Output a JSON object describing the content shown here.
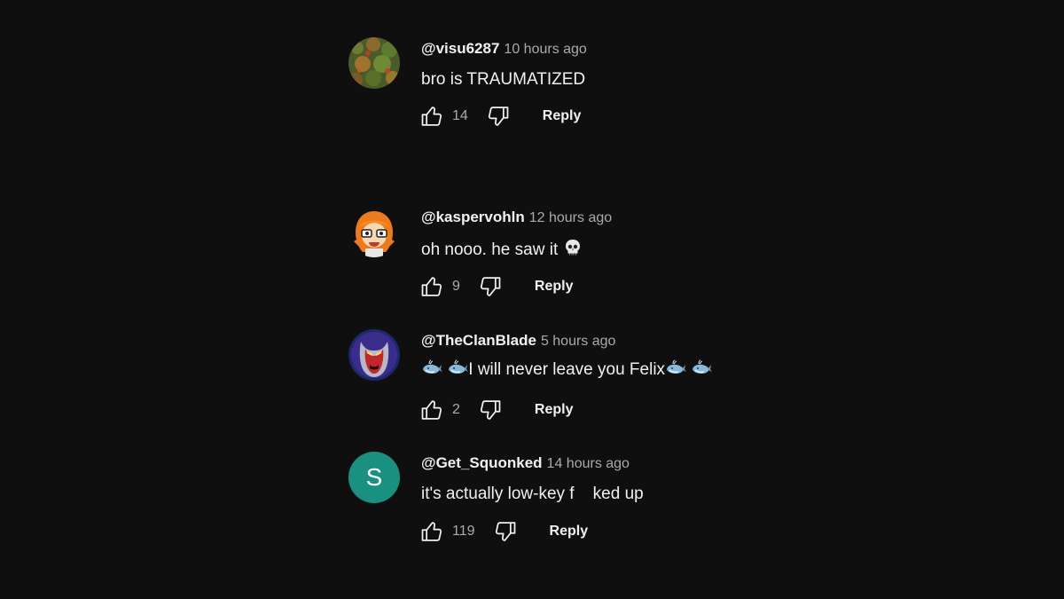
{
  "comments": [
    {
      "author": "@visu6287",
      "time": "10 hours ago",
      "text": "bro is TRAUMATIZED",
      "likes": "14",
      "reply_label": "Reply",
      "avatar": "forest-photo"
    },
    {
      "author": "@kaspervohln",
      "time": "12 hours ago",
      "text": "oh nooo. he saw it",
      "text_emoji": "skull-emoji",
      "likes": "9",
      "reply_label": "Reply",
      "avatar": "cartoon-girl-orange-hair"
    },
    {
      "author": "@TheClanBlade",
      "time": "5 hours ago",
      "text": "I will never leave you Felix",
      "text_emoji": "whale-emoji",
      "likes": "2",
      "reply_label": "Reply",
      "avatar": "red-demon-face"
    },
    {
      "author": "@Get_Squonked",
      "time": "14 hours ago",
      "text": "it's actually low-key f    ked up",
      "likes": "119",
      "reply_label": "Reply",
      "avatar_letter": "S",
      "avatar_color": "#1a9180"
    }
  ],
  "colors": {
    "background": "#0f0f0f",
    "text": "#f1f1f1",
    "secondary_text": "#aaaaaa"
  }
}
